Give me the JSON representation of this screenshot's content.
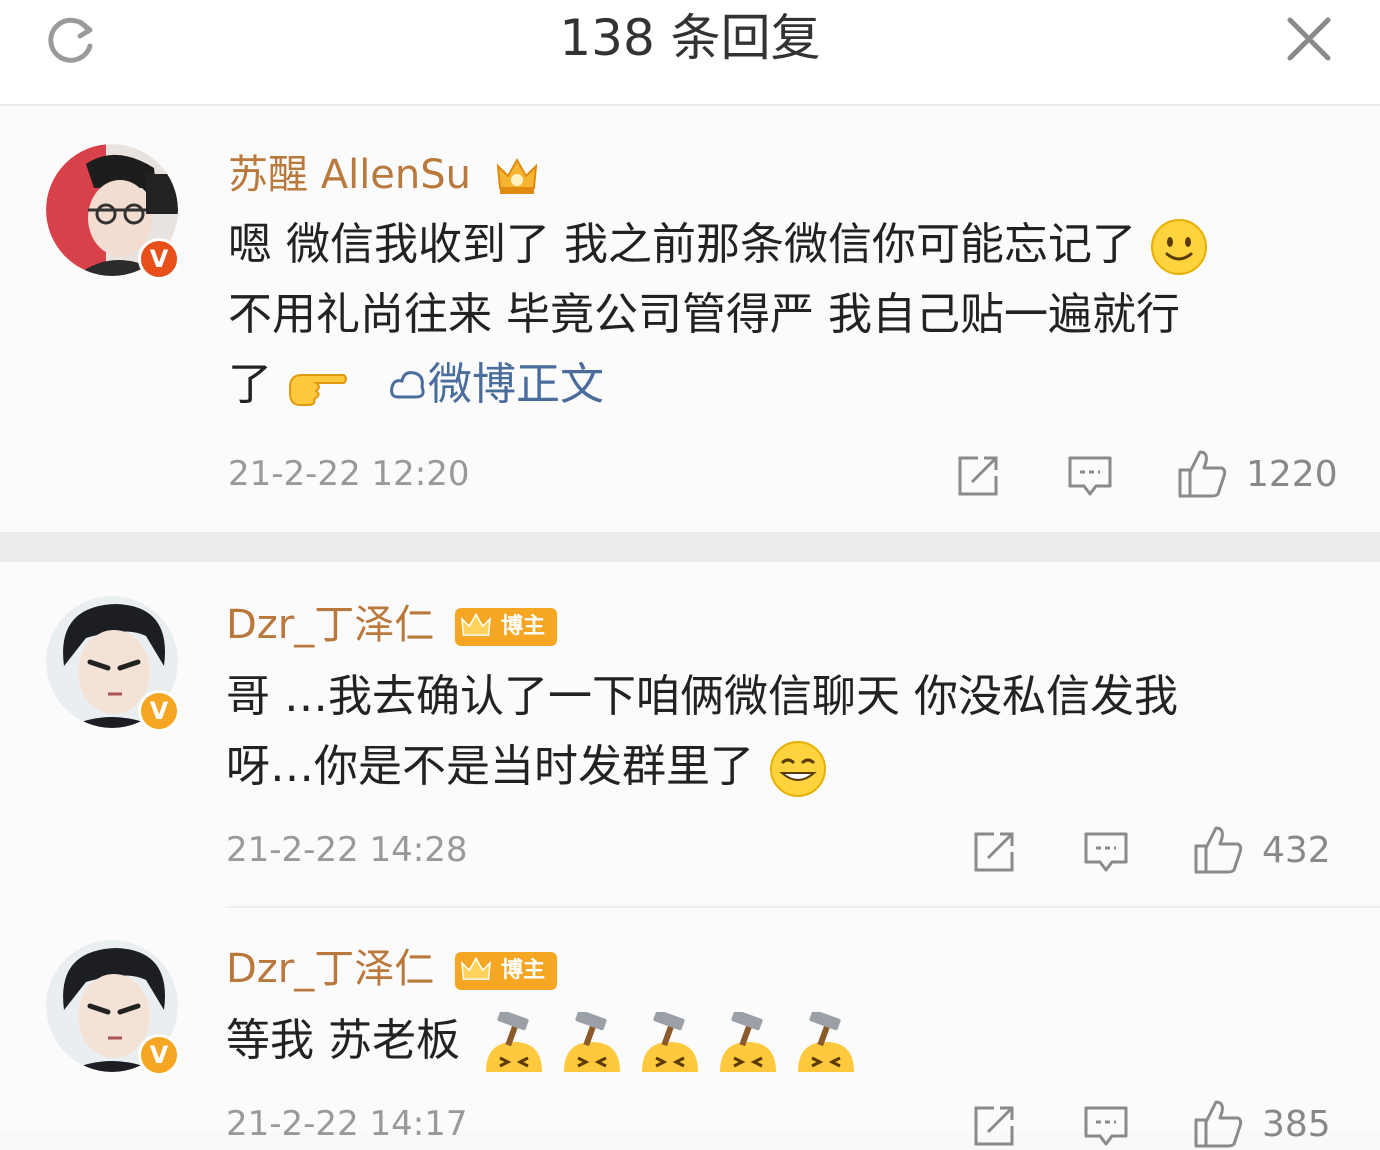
{
  "header": {
    "title": "138 条回复"
  },
  "comments": [
    {
      "username": "苏醒 AllenSu",
      "text_parts": [
        "嗯 微信我收到了 我之前那条微信你可能忘记了",
        "不用礼尚往来 毕竟公司管得严 我自己贴一遍就行",
        "了"
      ],
      "link": "微博正文",
      "time": "21-2-22 12:20",
      "likes": "1220"
    },
    {
      "username": "Dzr_丁泽仁",
      "badge": "博主",
      "text_parts": [
        "哥 …我去确认了一下咱俩微信聊天 你没私信发我",
        "呀…你是不是当时发群里了"
      ],
      "time": "21-2-22 14:28",
      "likes": "432"
    },
    {
      "username": "Dzr_丁泽仁",
      "badge": "博主",
      "text_parts": [
        "等我 苏老板"
      ],
      "time": "21-2-22 14:17",
      "likes": "385"
    }
  ],
  "icons": {
    "refresh": "refresh-icon",
    "close": "close-icon",
    "repost": "repost-icon",
    "comment": "comment-icon",
    "like": "thumbs-up-icon"
  },
  "colors": {
    "username": "#b9793d",
    "link": "#4a6d9c",
    "badge": "#f5a623"
  }
}
